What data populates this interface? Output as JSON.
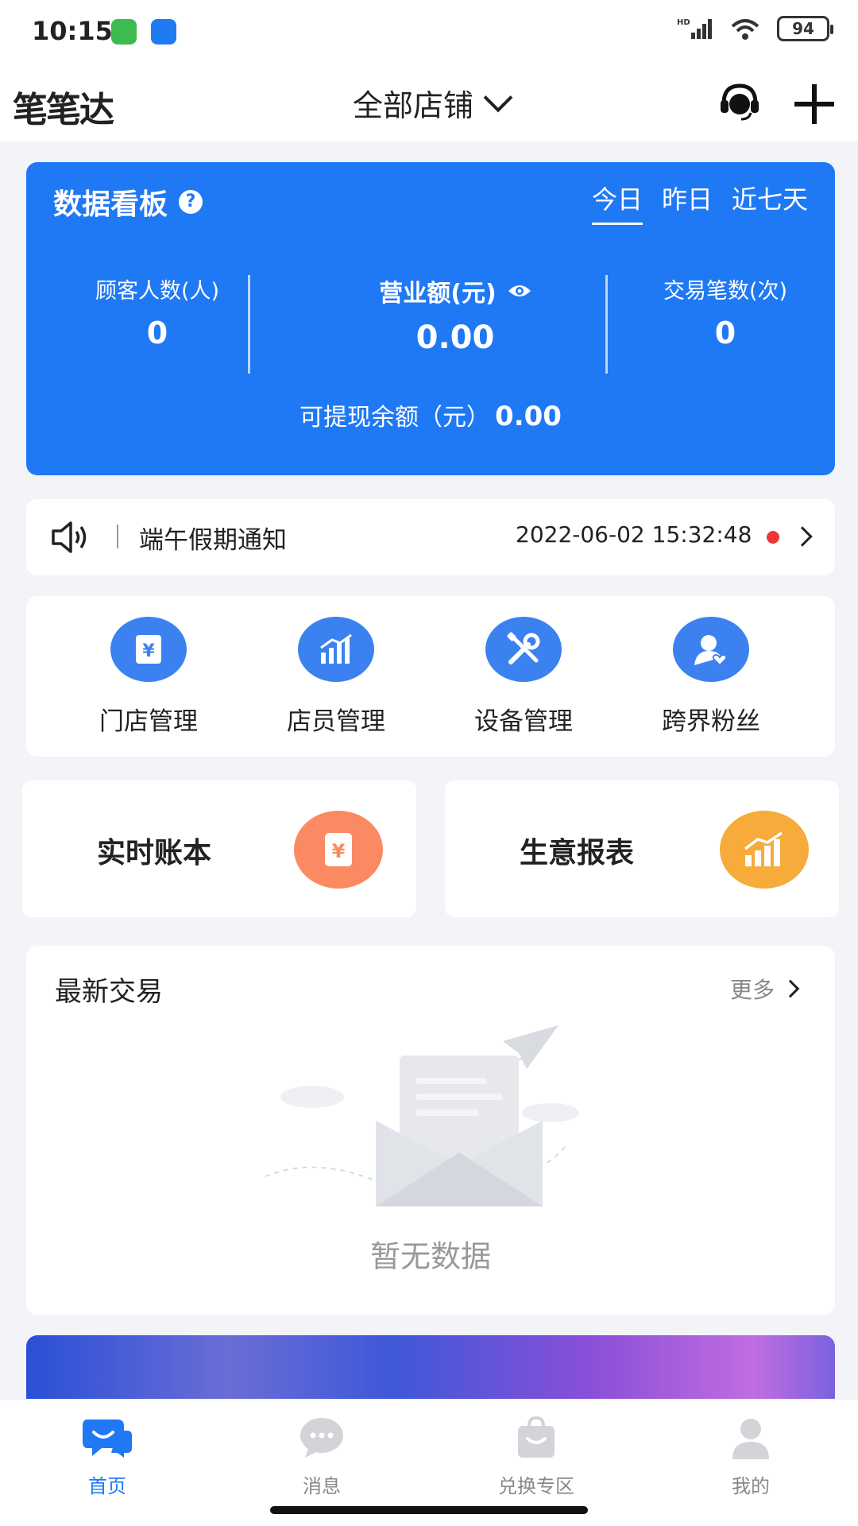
{
  "status_bar": {
    "time": "10:15",
    "battery": "94",
    "network": "HD"
  },
  "header": {
    "brand": "笔笔达",
    "store_selector": "全部店铺",
    "icons": [
      "headset-icon",
      "plus-icon"
    ]
  },
  "data_board": {
    "title": "数据看板",
    "tabs": [
      {
        "label": "今日",
        "active": true
      },
      {
        "label": "昨日",
        "active": false
      },
      {
        "label": "近七天",
        "active": false
      }
    ],
    "metrics": {
      "customers": {
        "label": "顾客人数(人)",
        "value": "0"
      },
      "revenue": {
        "label": "营业额(元)",
        "value": "0.00"
      },
      "transactions": {
        "label": "交易笔数(次)",
        "value": "0"
      }
    },
    "withdraw": {
      "label": "可提现余额（元）",
      "value": "0.00"
    },
    "accent_color": "#1f79f5"
  },
  "notice": {
    "title": "端午假期通知",
    "time": "2022-06-02 15:32:48",
    "unread_color": "#ee3636"
  },
  "quick_menu": [
    {
      "label": "门店管理",
      "icon": "store-ledger-icon"
    },
    {
      "label": "店员管理",
      "icon": "staff-chart-icon"
    },
    {
      "label": "设备管理",
      "icon": "tools-icon"
    },
    {
      "label": "跨界粉丝",
      "icon": "fans-icon"
    }
  ],
  "features": {
    "ledger": {
      "label": "实时账本",
      "icon": "ledger-icon",
      "color": "#fb8a62"
    },
    "report": {
      "label": "生意报表",
      "icon": "report-chart-icon",
      "color": "#f6ab3a"
    }
  },
  "latest": {
    "title": "最新交易",
    "more": "更多",
    "empty": "暂无数据"
  },
  "bottom_nav": [
    {
      "label": "首页",
      "icon": "home-chat-icon",
      "active": true
    },
    {
      "label": "消息",
      "icon": "message-icon",
      "active": false
    },
    {
      "label": "兑换专区",
      "icon": "exchange-bag-icon",
      "active": false
    },
    {
      "label": "我的",
      "icon": "profile-icon",
      "active": false
    }
  ]
}
